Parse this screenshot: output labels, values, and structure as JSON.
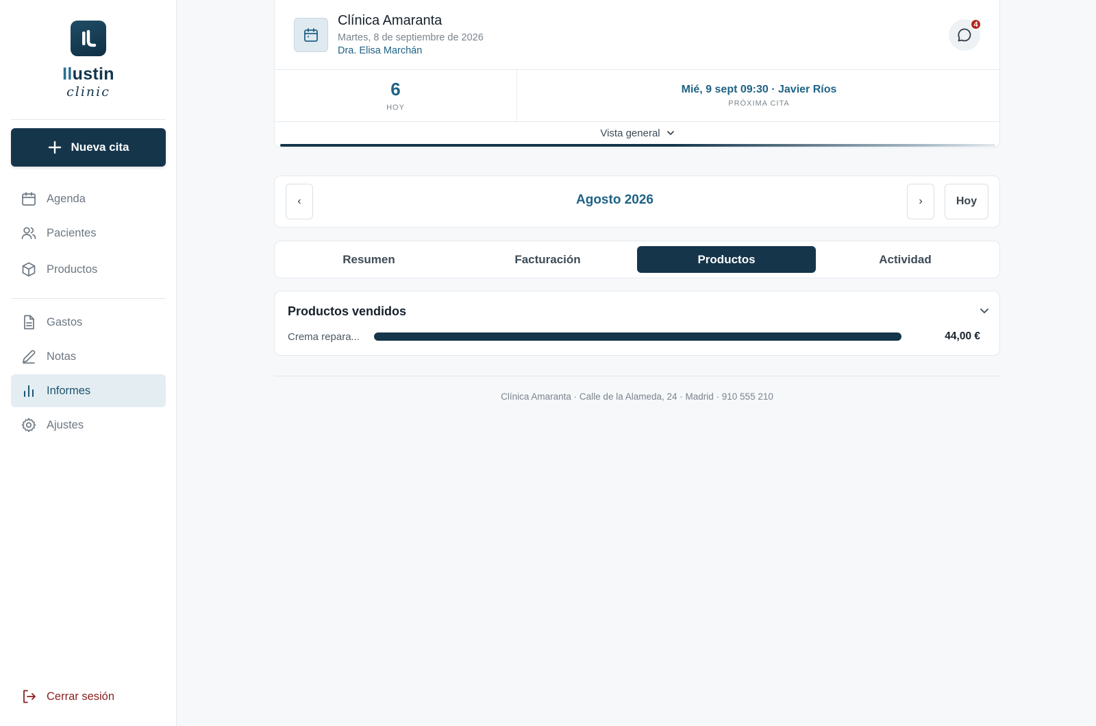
{
  "brand": {
    "name_prefix": "Il",
    "name_rest": "ustin",
    "sub": "clinic"
  },
  "sidebar": {
    "new_button": "Nueva cita",
    "items": [
      {
        "label": "Agenda",
        "icon": "calendar-icon"
      },
      {
        "label": "Pacientes",
        "icon": "users-icon"
      },
      {
        "label": "Productos",
        "icon": "box-icon"
      },
      {
        "label": "Gastos",
        "icon": "document-icon"
      },
      {
        "label": "Notas",
        "icon": "pencil-icon"
      },
      {
        "label": "Informes",
        "icon": "bar-chart-icon",
        "active": true
      },
      {
        "label": "Ajustes",
        "icon": "gear-icon"
      }
    ],
    "logout": "Cerrar sesión"
  },
  "header": {
    "clinic_name": "Clínica Amaranta",
    "date": "Martes, 8 de septiembre de 2026",
    "doctor": "Dra. Elisa Marchán",
    "notifications": "4",
    "today_count": "6",
    "today_label": "HOY",
    "next_appointment": "Mié, 9 sept 09:30 · Javier Ríos",
    "next_label": "PRÓXIMA CITA",
    "overview": "Vista general"
  },
  "month_nav": {
    "prev": "‹",
    "next": "›",
    "month": "Agosto 2026",
    "today": "Hoy"
  },
  "tabs": [
    {
      "label": "Resumen"
    },
    {
      "label": "Facturación"
    },
    {
      "label": "Productos",
      "active": true
    },
    {
      "label": "Actividad"
    }
  ],
  "products": {
    "title": "Productos vendidos",
    "items": [
      {
        "name": "Crema repara...",
        "value": "44,00 €",
        "fill_fraction": 1.0
      }
    ]
  },
  "footer": "Clínica Amaranta · Calle de la Alameda, 24 · Madrid · 910 555 210",
  "colors": {
    "primary": "#15354b",
    "accent": "#1f6285",
    "danger": "#8a1f1f",
    "badge": "#b3261e"
  }
}
